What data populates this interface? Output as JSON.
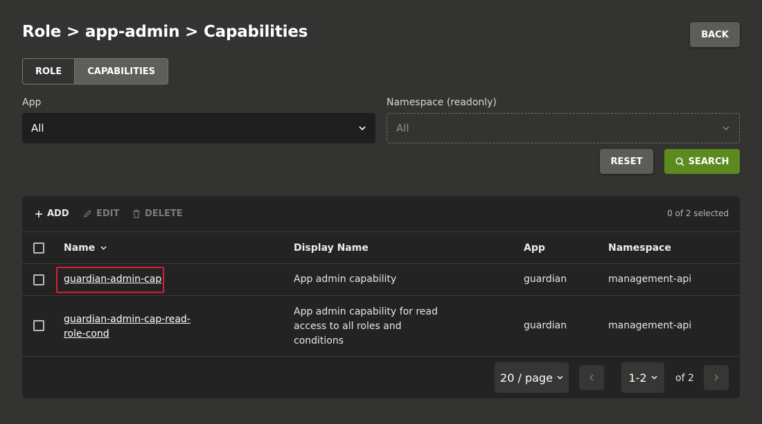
{
  "header": {
    "title": "Role > app-admin > Capabilities",
    "back_label": "BACK"
  },
  "tabs": [
    {
      "label": "ROLE",
      "active": false
    },
    {
      "label": "CAPABILITIES",
      "active": true
    }
  ],
  "filters": {
    "app": {
      "label": "App",
      "value": "All"
    },
    "namespace": {
      "label": "Namespace (readonly)",
      "value": "All"
    },
    "reset_label": "RESET",
    "search_label": "SEARCH"
  },
  "toolbar": {
    "add_label": "ADD",
    "edit_label": "EDIT",
    "delete_label": "DELETE",
    "selection_status": "0 of 2 selected"
  },
  "table": {
    "columns": [
      "Name",
      "Display Name",
      "App",
      "Namespace"
    ],
    "rows": [
      {
        "name": "guardian-admin-cap",
        "display_name": "App admin capability",
        "app": "guardian",
        "namespace": "management-api"
      },
      {
        "name_line1": "guardian-admin-cap-read-",
        "name_line2": "role-cond",
        "display_line1": "App admin capability for read",
        "display_line2": "access to all roles and",
        "display_line3": "conditions",
        "app": "guardian",
        "namespace": "management-api"
      }
    ]
  },
  "pagination": {
    "page_size": "20 / page",
    "range": "1-2",
    "total": "of 2"
  },
  "colors": {
    "background": "#333331",
    "primary_button": "#5b8a1f",
    "highlight": "#d4203a"
  }
}
